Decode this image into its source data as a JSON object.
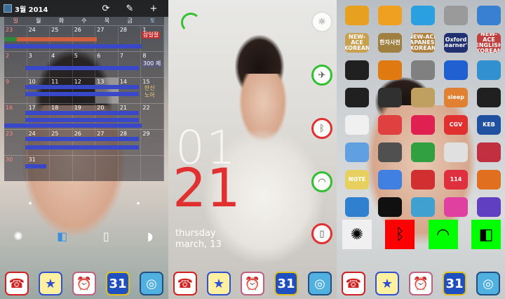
{
  "calendar": {
    "month_label": "3월 2014",
    "weekdays": [
      "일",
      "월",
      "화",
      "수",
      "목",
      "금",
      "토"
    ],
    "weeks": [
      [
        "23",
        "24",
        "25",
        "26",
        "27",
        "28",
        "1"
      ],
      [
        "2",
        "3",
        "4",
        "5",
        "6",
        "7",
        "8"
      ],
      [
        "9",
        "10",
        "11",
        "12",
        "13",
        "14",
        "15"
      ],
      [
        "16",
        "17",
        "18",
        "19",
        "20",
        "21",
        "22"
      ],
      [
        "23",
        "24",
        "25",
        "26",
        "27",
        "28",
        "29"
      ],
      [
        "30",
        "31",
        "",
        "",
        "",
        "",
        ""
      ]
    ],
    "notes": {
      "holiday": "삼일절",
      "count": "300 제",
      "special1": "만신",
      "special2": "노아"
    },
    "nav_prev": "◂",
    "nav_next": "▸"
  },
  "lockscreen": {
    "hour": "01",
    "minute": "21",
    "weekday": "thursday",
    "date": "march, 13"
  },
  "apps": [
    {
      "label": "",
      "color": "#e8a020"
    },
    {
      "label": "",
      "color": "#f0a020"
    },
    {
      "label": "",
      "color": "#2aa0e0"
    },
    {
      "label": "",
      "color": "#9a9a9a"
    },
    {
      "label": "",
      "color": "#3a80d0"
    },
    {
      "label": "NEW-ACE KOREAN",
      "color": "#c8a050"
    },
    {
      "label": "한자사전",
      "color": "#a08040"
    },
    {
      "label": "NEW-ACE JAPANESE KOREAN",
      "color": "#b08040"
    },
    {
      "label": "Oxford Learner's",
      "color": "#203070"
    },
    {
      "label": "NEW-ACE ENGLISH KOREAN",
      "color": "#c04040"
    },
    {
      "label": "",
      "color": "#202020"
    },
    {
      "label": "",
      "color": "#e07a10"
    },
    {
      "label": "",
      "color": "#808080"
    },
    {
      "label": "",
      "color": "#2060d0"
    },
    {
      "label": "",
      "color": "#3090d0"
    },
    {
      "label": "",
      "color": "#202020"
    },
    {
      "label": "",
      "color": "#303030"
    },
    {
      "label": "",
      "color": "#c0a060"
    },
    {
      "label": "sleep",
      "color": "#e08030"
    },
    {
      "label": "",
      "color": "#202020"
    },
    {
      "label": "",
      "color": "#f0f0f0"
    },
    {
      "label": "",
      "color": "#e04040"
    },
    {
      "label": "",
      "color": "#e02050"
    },
    {
      "label": "CGV",
      "color": "#e03030"
    },
    {
      "label": "KEB",
      "color": "#2050a0"
    },
    {
      "label": "",
      "color": "#60a0e0"
    },
    {
      "label": "",
      "color": "#505050"
    },
    {
      "label": "",
      "color": "#30a040"
    },
    {
      "label": "",
      "color": "#e0e0e0"
    },
    {
      "label": "",
      "color": "#c03040"
    },
    {
      "label": "NOTE",
      "color": "#e8d060"
    },
    {
      "label": "",
      "color": "#4080e0"
    },
    {
      "label": "",
      "color": "#d03030"
    },
    {
      "label": "114",
      "color": "#e03040"
    },
    {
      "label": "",
      "color": "#e07020"
    },
    {
      "label": "",
      "color": "#3080d0"
    },
    {
      "label": "",
      "color": "#101010"
    },
    {
      "label": "",
      "color": "#40a0d0"
    },
    {
      "label": "",
      "color": "#e040a0"
    },
    {
      "label": "",
      "color": "#6040c0"
    }
  ],
  "icons": {
    "phone": "☎",
    "star": "★",
    "alarm": "⏰",
    "calendar_num": "31",
    "camera": "◎",
    "refresh": "⟳",
    "wrench": "✎",
    "plus": "+",
    "settings": "✺",
    "brightness": "☼",
    "rotate": "◧",
    "vibrate": "▯",
    "nfc": "◗",
    "airplane": "✈",
    "bluetooth": "ᛒ",
    "wifi": "◠",
    "phone_mode": "▯"
  },
  "colors": {
    "lock_accent_red": "#e03030",
    "lock_accent_green": "#30c030",
    "toggle_red": "#ff0000",
    "toggle_green": "#00ff00"
  }
}
